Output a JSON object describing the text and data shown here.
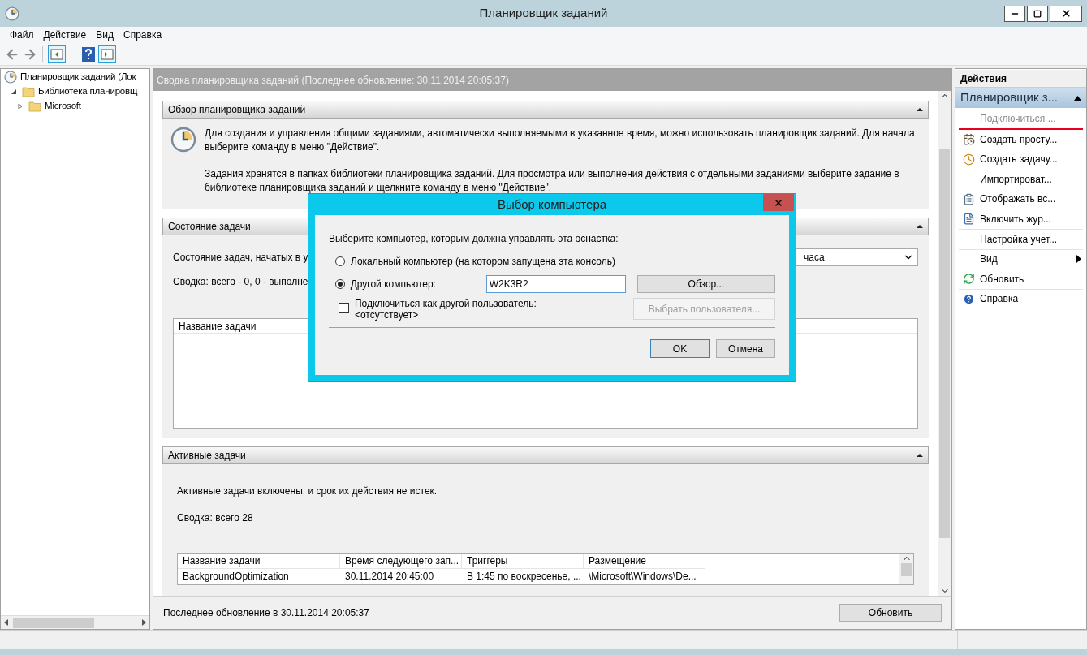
{
  "window": {
    "title": "Планировщик заданий"
  },
  "menu": [
    "Файл",
    "Действие",
    "Вид",
    "Справка"
  ],
  "tree": [
    {
      "label": "Планировщик заданий (Лок",
      "children": [
        {
          "label": "Библиотека планировщ",
          "expanded": true,
          "children": [
            {
              "label": "Microsoft",
              "expanded": false
            }
          ]
        }
      ]
    }
  ],
  "summary_header": "Сводка планировщика заданий (Последнее обновление: 30.11.2014 20:05:37)",
  "overview": {
    "title": "Обзор планировщика заданий",
    "paragraphs": [
      "Для создания и управления общими заданиями, автоматически выполняемыми в указанное время, можно использовать планировщик заданий. Для начала выберите команду в меню \"Действие\".",
      "Задания хранятся в папках библиотеки планировщика заданий. Для просмотра или выполнения действия с отдельными заданиями выберите задание в библиотеке планировщика заданий и щелкните команду в меню \"Действие\"."
    ]
  },
  "task_status": {
    "title": "Состояние задачи",
    "filter_label": "Состояние задач, начатых в у",
    "period": "часа",
    "summary": "Сводка: всего - 0, 0 - выполне",
    "columns": [
      "Название задачи"
    ]
  },
  "active_tasks": {
    "title": "Активные задачи",
    "description": "Активные задачи включены, и срок их действия не истек.",
    "summary": "Сводка: всего 28",
    "columns": [
      "Название задачи",
      "Время следующего зап...",
      "Триггеры",
      "Размещение"
    ],
    "rows": [
      [
        "BackgroundOptimization",
        "30.11.2014 20:45:00",
        "В 1:45 по воскресенье, ...",
        "\\Microsoft\\Windows\\De..."
      ]
    ]
  },
  "footer": {
    "text": "Последнее обновление в 30.11.2014 20:05:37",
    "button": "Обновить"
  },
  "actions": {
    "title": "Действия",
    "group": "Планировщик з...",
    "items": [
      {
        "label": "Подключиться ...",
        "kind": "command",
        "disabled": true,
        "marked": true
      },
      {
        "label": "Создать просту...",
        "kind": "command",
        "disabled": false,
        "marked": false
      },
      {
        "label": "Создать задачу...",
        "kind": "command",
        "disabled": false,
        "marked": false
      },
      {
        "label": "Импортироват...",
        "kind": "command",
        "disabled": false,
        "marked": false
      },
      {
        "label": "Отображать вс...",
        "kind": "command",
        "disabled": false,
        "marked": false
      },
      {
        "label": "Включить жур...",
        "kind": "command",
        "disabled": false,
        "marked": false
      },
      {
        "label": "Настройка учет...",
        "kind": "command",
        "disabled": false,
        "marked": false
      },
      {
        "label": "Вид",
        "kind": "submenu",
        "disabled": false,
        "marked": false
      },
      {
        "label": "Обновить",
        "kind": "command",
        "disabled": false,
        "marked": false
      },
      {
        "label": "Справка",
        "kind": "command",
        "disabled": false,
        "marked": false
      }
    ]
  },
  "dialog": {
    "title": "Выбор компьютера",
    "prompt": "Выберите компьютер, которым должна управлять эта оснастка:",
    "options": [
      {
        "label": "Локальный компьютер (на котором запущена эта консоль)",
        "selected": false
      },
      {
        "label": "Другой компьютер:",
        "selected": true
      }
    ],
    "computer_name": "W2K3R2",
    "browse_button": "Обзор...",
    "connect_as": {
      "label": "Подключиться как другой пользователь:",
      "checked": false,
      "user": "<отсутствует>"
    },
    "select_user_button": {
      "label": "Выбрать пользователя...",
      "disabled": true
    },
    "buttons": [
      "OK",
      "Отмена"
    ]
  }
}
